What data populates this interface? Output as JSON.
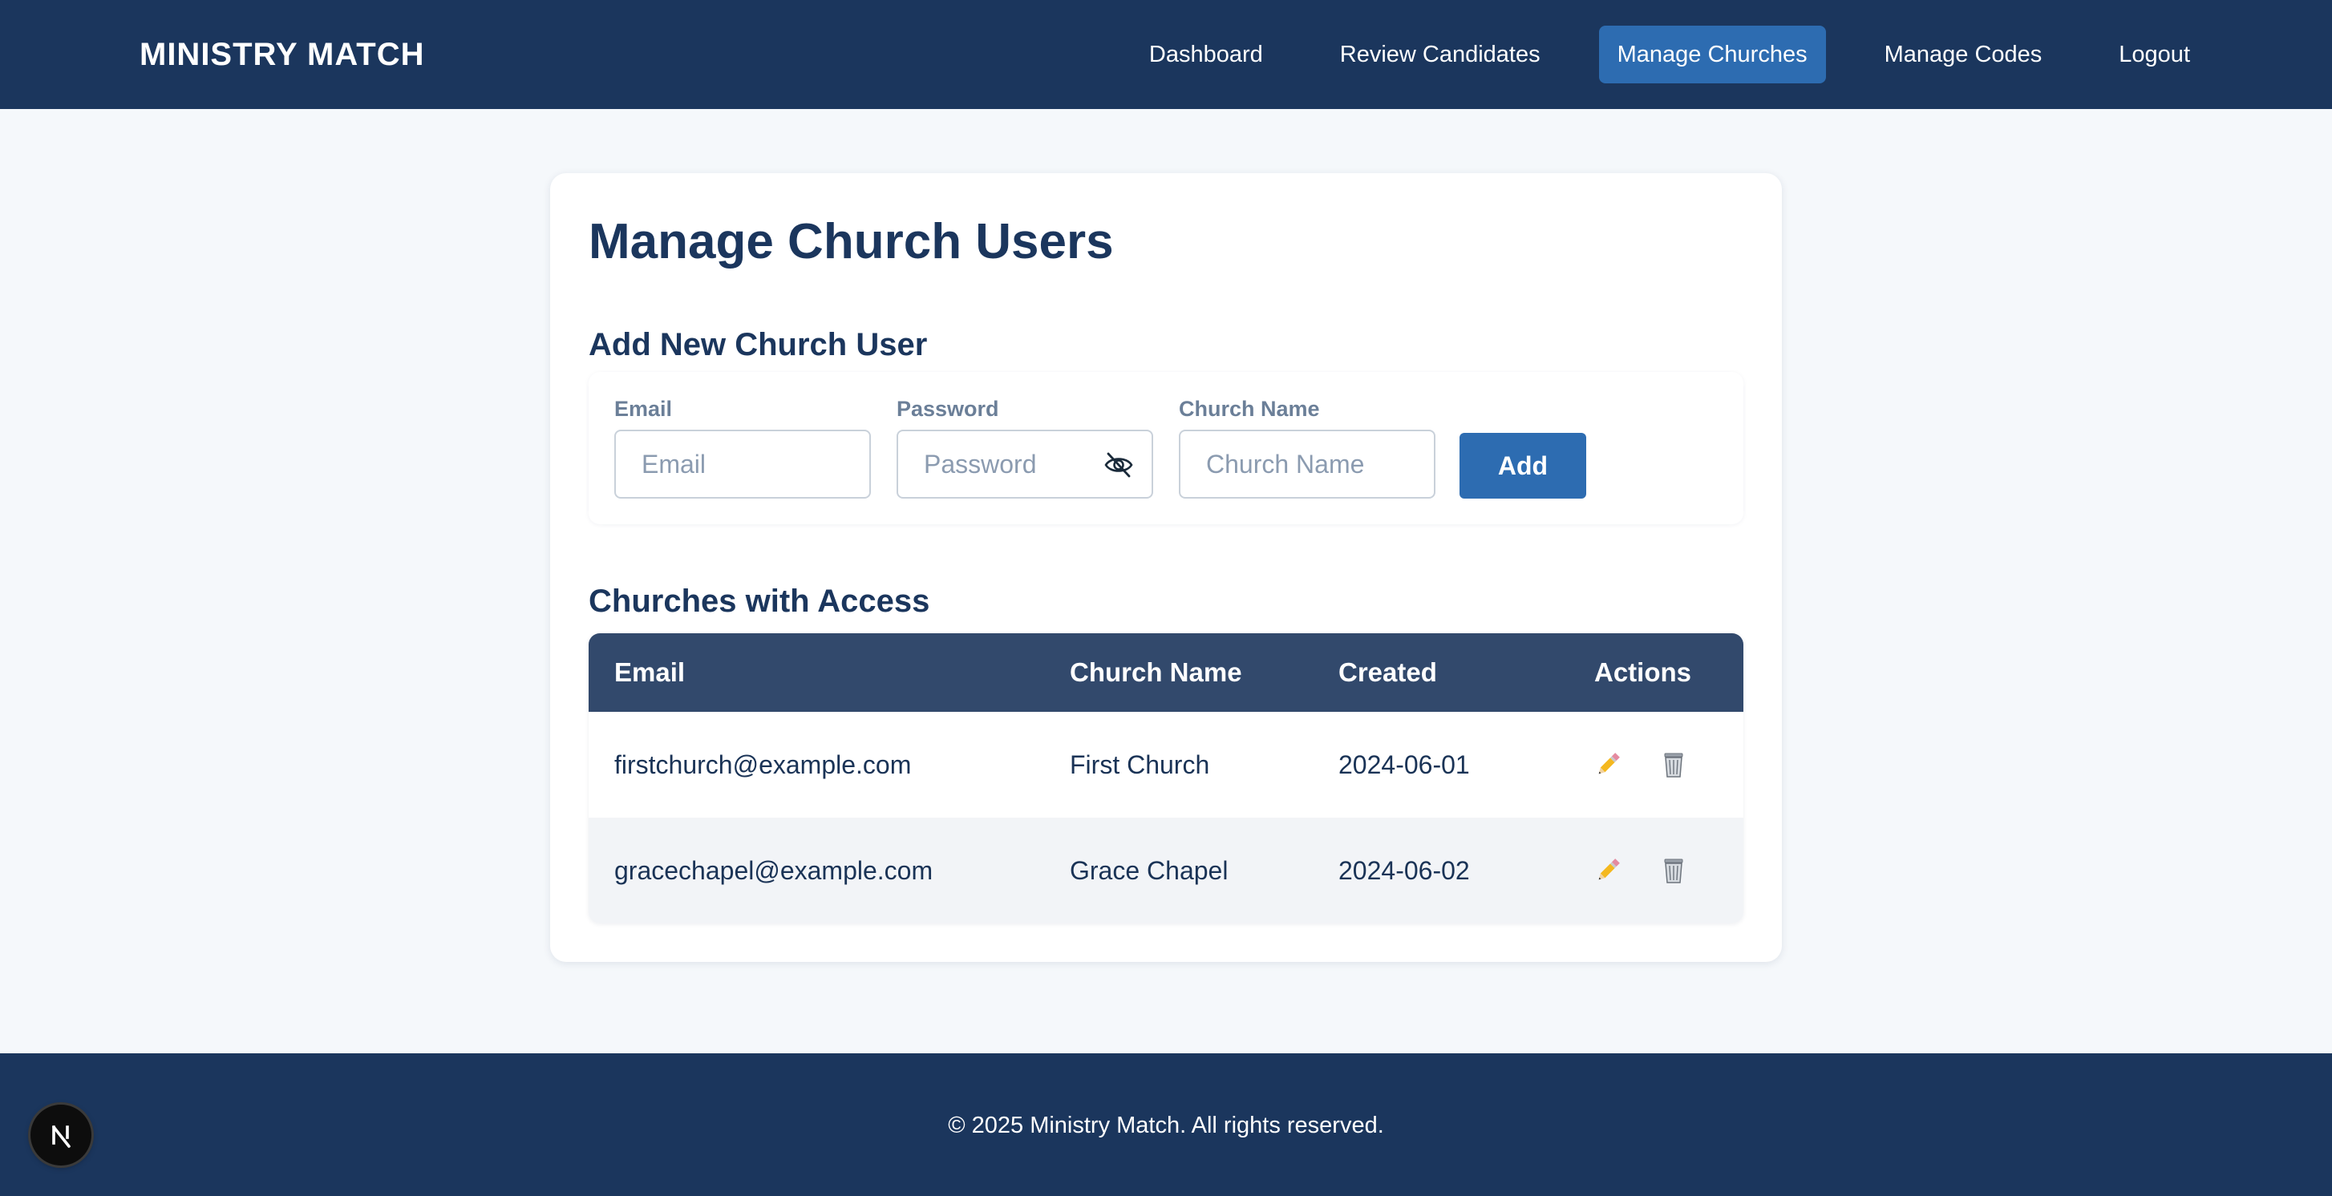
{
  "header": {
    "brand": "MINISTRY MATCH",
    "nav": [
      {
        "label": "Dashboard"
      },
      {
        "label": "Review Candidates"
      },
      {
        "label": "Manage Churches",
        "active": true
      },
      {
        "label": "Manage Codes"
      },
      {
        "label": "Logout"
      }
    ]
  },
  "main": {
    "title": "Manage Church Users",
    "add_section_title": "Add New Church User",
    "form": {
      "email_label": "Email",
      "email_placeholder": "Email",
      "password_label": "Password",
      "password_placeholder": "Password",
      "church_label": "Church Name",
      "church_placeholder": "Church Name",
      "add_label": "Add"
    },
    "list_section_title": "Churches with Access",
    "table": {
      "headers": [
        "Email",
        "Church Name",
        "Created",
        "Actions"
      ],
      "rows": [
        {
          "email": "firstchurch@example.com",
          "church": "First Church",
          "created": "2024-06-01"
        },
        {
          "email": "gracechapel@example.com",
          "church": "Grace Chapel",
          "created": "2024-06-02"
        }
      ]
    }
  },
  "footer": {
    "text": "© 2025 Ministry Match. All rights reserved."
  },
  "colors": {
    "header_bg": "#1b365d",
    "accent": "#2d6cb1",
    "table_header_bg": "#32496c",
    "page_bg": "#f5f8fb"
  },
  "icons": {
    "password_toggle": "eye-off-icon",
    "edit": "pencil-icon",
    "delete": "trash-icon",
    "dev_badge": "nextjs-logo-icon"
  }
}
